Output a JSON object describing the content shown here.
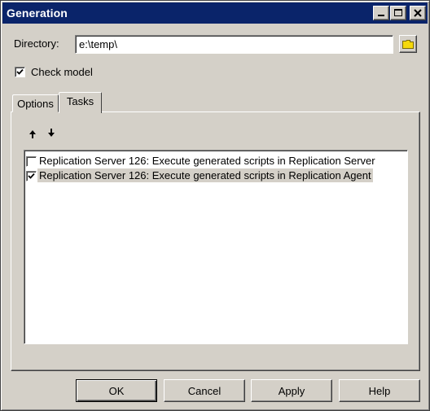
{
  "window": {
    "title": "Generation"
  },
  "directory": {
    "label": "Directory:",
    "value": "e:\\temp\\",
    "browse_icon": "folder-icon"
  },
  "check_model": {
    "label": "Check model",
    "checked": true
  },
  "tabs": [
    {
      "label": "Options",
      "active": false
    },
    {
      "label": "Tasks",
      "active": true
    }
  ],
  "task_toolbar": {
    "move_up_icon": "arrow-up-icon",
    "move_down_icon": "arrow-down-icon"
  },
  "tasks": [
    {
      "label": "Replication Server 126: Execute generated scripts in Replication Server",
      "checked": false,
      "selected": false
    },
    {
      "label": "Replication Server 126: Execute generated scripts in Replication Agent",
      "checked": true,
      "selected": true
    }
  ],
  "buttons": {
    "ok": "OK",
    "cancel": "Cancel",
    "apply": "Apply",
    "help": "Help"
  },
  "colors": {
    "titlebar": "#0a246a",
    "face": "#d4d0c8",
    "folder": "#f5d90a"
  }
}
